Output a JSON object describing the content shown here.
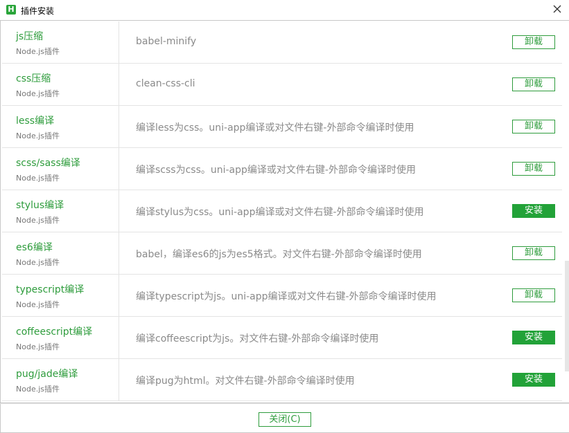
{
  "window": {
    "title": "插件安装",
    "app_icon_glyph": "H",
    "icon": "close-icon"
  },
  "colors": {
    "accent": "#2e9c3c",
    "install_fill": "#22a238"
  },
  "plugins": [
    {
      "name": "js压缩",
      "type": "Node.js插件",
      "description": "babel-minify",
      "action": "卸载",
      "state": "installed"
    },
    {
      "name": "css压缩",
      "type": "Node.js插件",
      "description": "clean-css-cli",
      "action": "卸载",
      "state": "installed"
    },
    {
      "name": "less编译",
      "type": "Node.js插件",
      "description": "编译less为css。uni-app编译或对文件右键-外部命令编译时使用",
      "action": "卸载",
      "state": "installed"
    },
    {
      "name": "scss/sass编译",
      "type": "Node.js插件",
      "description": "编译scss为css。uni-app编译或对文件右键-外部命令编译时使用",
      "action": "卸载",
      "state": "installed"
    },
    {
      "name": "stylus编译",
      "type": "Node.js插件",
      "description": "编译stylus为css。uni-app编译或对文件右键-外部命令编译时使用",
      "action": "安装",
      "state": "not-installed"
    },
    {
      "name": "es6编译",
      "type": "Node.js插件",
      "description": "babel，编译es6的js为es5格式。对文件右键-外部命令编译时使用",
      "action": "卸载",
      "state": "installed"
    },
    {
      "name": "typescript编译",
      "type": "Node.js插件",
      "description": "编译typescript为js。uni-app编译或对文件右键-外部命令编译时使用",
      "action": "卸载",
      "state": "installed"
    },
    {
      "name": "coffeescript编译",
      "type": "Node.js插件",
      "description": "编译coffeescript为js。对文件右键-外部命令编译时使用",
      "action": "安装",
      "state": "not-installed"
    },
    {
      "name": "pug/jade编译",
      "type": "Node.js插件",
      "description": "编译pug为html。对文件右键-外部命令编译时使用",
      "action": "安装",
      "state": "not-installed"
    }
  ],
  "footer": {
    "close_label": "关闭(C)"
  }
}
